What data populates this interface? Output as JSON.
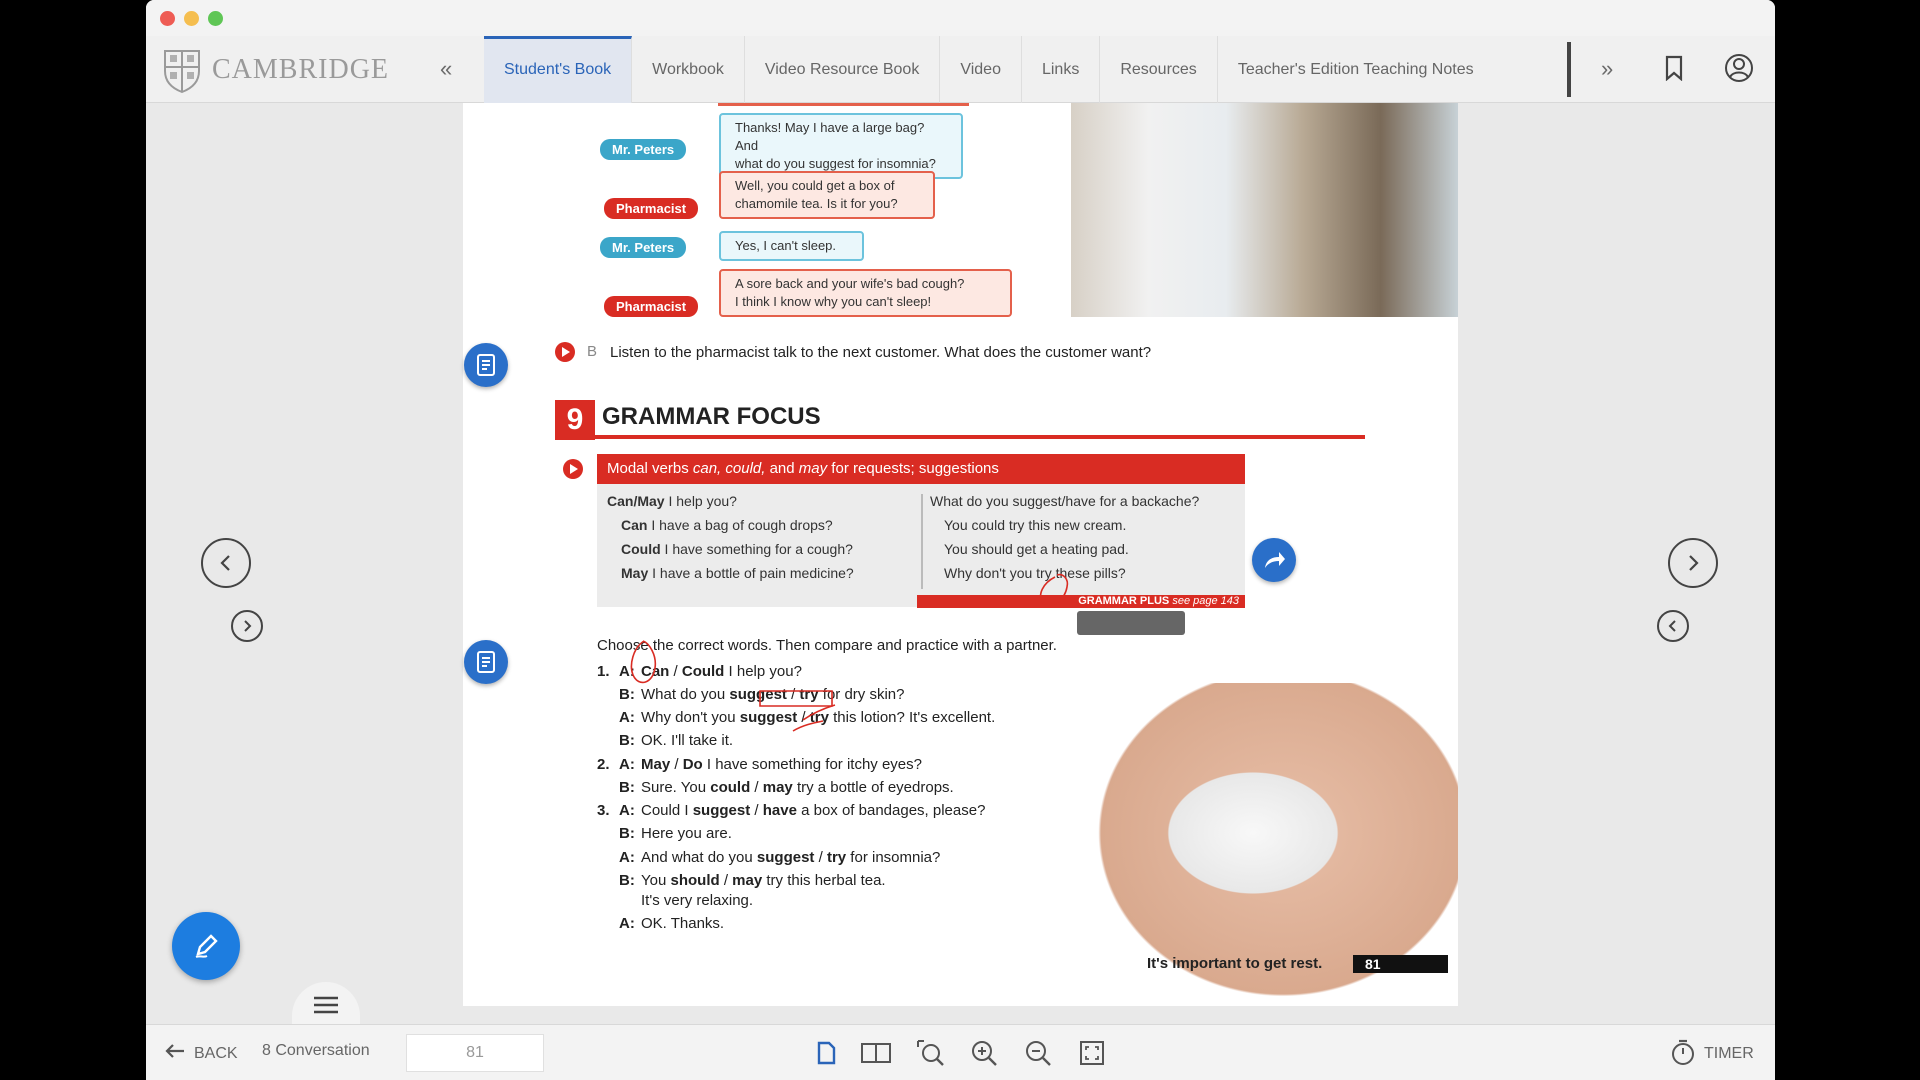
{
  "app": {
    "logo_text": "CAMBRIDGE",
    "tabs": [
      {
        "label": "Student's Book",
        "active": true
      },
      {
        "label": "Workbook",
        "active": false
      },
      {
        "label": "Video Resource Book",
        "active": false
      },
      {
        "label": "Video",
        "active": false
      },
      {
        "label": "Links",
        "active": false
      },
      {
        "label": "Resources",
        "active": false
      },
      {
        "label": "Teacher's Edition Teaching Notes",
        "active": false
      }
    ],
    "icons": {
      "prev_tabs": "double-chevron-left-icon",
      "next_tabs": "double-chevron-right-icon",
      "bookmark": "bookmark-icon",
      "profile": "user-profile-icon"
    }
  },
  "conversation": [
    {
      "speaker": "Mr. Peters",
      "role": "customer",
      "line1": "Thanks! May I have a large bag? And",
      "line2": "what do you suggest for insomnia?"
    },
    {
      "speaker": "Pharmacist",
      "role": "pharmacist",
      "line1": "Well, you could get a box of",
      "line2": "chamomile tea. Is it for you?"
    },
    {
      "speaker": "Mr. Peters",
      "role": "customer",
      "line1": "Yes, I can't sleep.",
      "line2": ""
    },
    {
      "speaker": "Pharmacist",
      "role": "pharmacist",
      "line1": "A sore back and your wife's bad cough?",
      "line2": "I think I know why you can't sleep!"
    }
  ],
  "exercise_b": {
    "letter": "B",
    "text": "Listen to the pharmacist talk to the next customer. What does the customer want?"
  },
  "grammar": {
    "number": "9",
    "title": "GRAMMAR FOCUS",
    "box_title_a": "Modal verbs ",
    "box_title_italic": "can, could,",
    "box_title_b": " and ",
    "box_title_italic2": "may",
    "box_title_c": " for requests; suggestions",
    "left": [
      {
        "bold": "Can/May",
        "rest": " I help you?"
      },
      {
        "bold": "Can",
        "rest": " I have a bag of cough drops?"
      },
      {
        "bold": "Could",
        "rest": " I have something for a cough?"
      },
      {
        "bold": "May",
        "rest": " I have a bottle of pain medicine?"
      }
    ],
    "right": [
      "What do you suggest/have for a backache?",
      "You could try this new cream.",
      "You should get a heating pad.",
      "Why don't you try these pills?"
    ],
    "grammar_plus": "GRAMMAR PLUS",
    "grammar_plus_ref": "see page 143"
  },
  "practice": {
    "instruction": "Choose the correct words. Then compare and practice with a partner.",
    "lines": [
      {
        "num": "1.",
        "who": "A:",
        "parts": [
          [
            "b",
            "Can"
          ],
          [
            "n",
            " / "
          ],
          [
            "b",
            "Could"
          ],
          [
            "n",
            " I help you?"
          ]
        ]
      },
      {
        "num": "",
        "who": "B:",
        "parts": [
          [
            "n",
            "What do you "
          ],
          [
            "b",
            "suggest"
          ],
          [
            "n",
            " / "
          ],
          [
            "b",
            "try"
          ],
          [
            "n",
            " for dry skin?"
          ]
        ]
      },
      {
        "num": "",
        "who": "A:",
        "parts": [
          [
            "n",
            "Why don't you "
          ],
          [
            "b",
            "suggest"
          ],
          [
            "n",
            " / "
          ],
          [
            "b",
            "try"
          ],
          [
            "n",
            " this lotion? It's excellent."
          ]
        ]
      },
      {
        "num": "",
        "who": "B:",
        "parts": [
          [
            "n",
            "OK. I'll take it."
          ]
        ]
      },
      {
        "num": "2.",
        "who": "A:",
        "parts": [
          [
            "b",
            "May"
          ],
          [
            "n",
            " / "
          ],
          [
            "b",
            "Do"
          ],
          [
            "n",
            " I have something for itchy eyes?"
          ]
        ]
      },
      {
        "num": "",
        "who": "B:",
        "parts": [
          [
            "n",
            "Sure. You "
          ],
          [
            "b",
            "could"
          ],
          [
            "n",
            " / "
          ],
          [
            "b",
            "may"
          ],
          [
            "n",
            " try a bottle of eyedrops."
          ]
        ]
      },
      {
        "num": "3.",
        "who": "A:",
        "parts": [
          [
            "n",
            "Could I "
          ],
          [
            "b",
            "suggest"
          ],
          [
            "n",
            " / "
          ],
          [
            "b",
            "have"
          ],
          [
            "n",
            " a box of bandages, please?"
          ]
        ]
      },
      {
        "num": "",
        "who": "B:",
        "parts": [
          [
            "n",
            "Here you are."
          ]
        ]
      },
      {
        "num": "",
        "who": "A:",
        "parts": [
          [
            "n",
            "And what do you "
          ],
          [
            "b",
            "suggest"
          ],
          [
            "n",
            " / "
          ],
          [
            "b",
            "try"
          ],
          [
            "n",
            " for insomnia?"
          ]
        ]
      },
      {
        "num": "",
        "who": "B:",
        "parts": [
          [
            "n",
            "You "
          ],
          [
            "b",
            "should"
          ],
          [
            "n",
            " / "
          ],
          [
            "b",
            "may"
          ],
          [
            "n",
            " try this herbal tea."
          ]
        ]
      },
      {
        "num": "",
        "who": "",
        "parts": [
          [
            "n",
            "It's very relaxing."
          ]
        ]
      },
      {
        "num": "",
        "who": "A:",
        "parts": [
          [
            "n",
            "OK. Thanks."
          ]
        ]
      }
    ]
  },
  "page_footer": {
    "caption": "It's important to get rest.",
    "page_number": "81"
  },
  "bottom": {
    "back_label": "BACK",
    "unit_label": "8 Conversation",
    "page_value": "81",
    "timer_label": "TIMER"
  },
  "colors": {
    "accent_blue": "#2a64b8",
    "cambridge_red": "#d92c23",
    "speaker_blue": "#3ba6c9"
  }
}
